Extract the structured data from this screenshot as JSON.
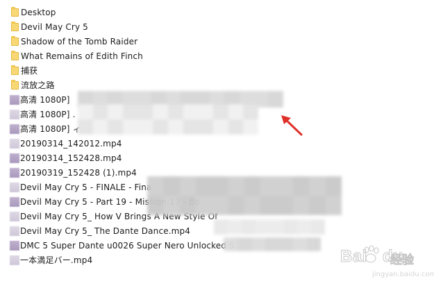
{
  "explorer": {
    "items": [
      {
        "type": "folder",
        "icon": "folder-icon",
        "name": "Desktop"
      },
      {
        "type": "folder",
        "icon": "folder-icon",
        "name": "Devil May Cry 5"
      },
      {
        "type": "folder",
        "icon": "folder-icon",
        "name": "Shadow of the Tomb Raider"
      },
      {
        "type": "folder",
        "icon": "folder-icon",
        "name": "What Remains of Edith Finch"
      },
      {
        "type": "folder",
        "icon": "folder-icon",
        "name": "捕获"
      },
      {
        "type": "folder",
        "icon": "folder-icon",
        "name": "流放之路"
      },
      {
        "type": "video",
        "icon": "video-file-icon",
        "name": "高清 1080P]"
      },
      {
        "type": "video",
        "icon": "video-file-icon",
        "name": "高清 1080P] ."
      },
      {
        "type": "video",
        "icon": "video-file-icon",
        "name": "高清 1080P] ィ"
      },
      {
        "type": "video",
        "icon": "video-file-icon",
        "name": "20190314_142012.mp4"
      },
      {
        "type": "video",
        "icon": "video-file-icon",
        "name": "20190314_152428.mp4"
      },
      {
        "type": "video",
        "icon": "video-file-icon",
        "name": "20190319_152428 (1).mp4"
      },
      {
        "type": "video",
        "icon": "video-file-icon",
        "name": "Devil May Cry 5 - FINALE - Fina"
      },
      {
        "type": "video",
        "icon": "video-file-icon",
        "name": "Devil May Cry 5 - Part 19 - Mission 17 - Bo"
      },
      {
        "type": "video",
        "icon": "video-file-icon",
        "name": "Devil May Cry 5_ How V Brings A New Style Of"
      },
      {
        "type": "video",
        "icon": "video-file-icon",
        "name": "Devil May Cry 5_ The Dante Dance.mp4"
      },
      {
        "type": "video",
        "icon": "video-file-icon",
        "name": "DMC 5 Super Dante u0026 Super Nero Unlocked S"
      },
      {
        "type": "video",
        "icon": "video-file-icon",
        "name": "一本満足バー.mp4"
      }
    ]
  },
  "annotation": {
    "arrow_color": "#e0302a"
  },
  "watermark": {
    "brand": "Bai",
    "brand_suffix": "du",
    "cn": "经验",
    "url": "jingyan.baidu.com"
  }
}
